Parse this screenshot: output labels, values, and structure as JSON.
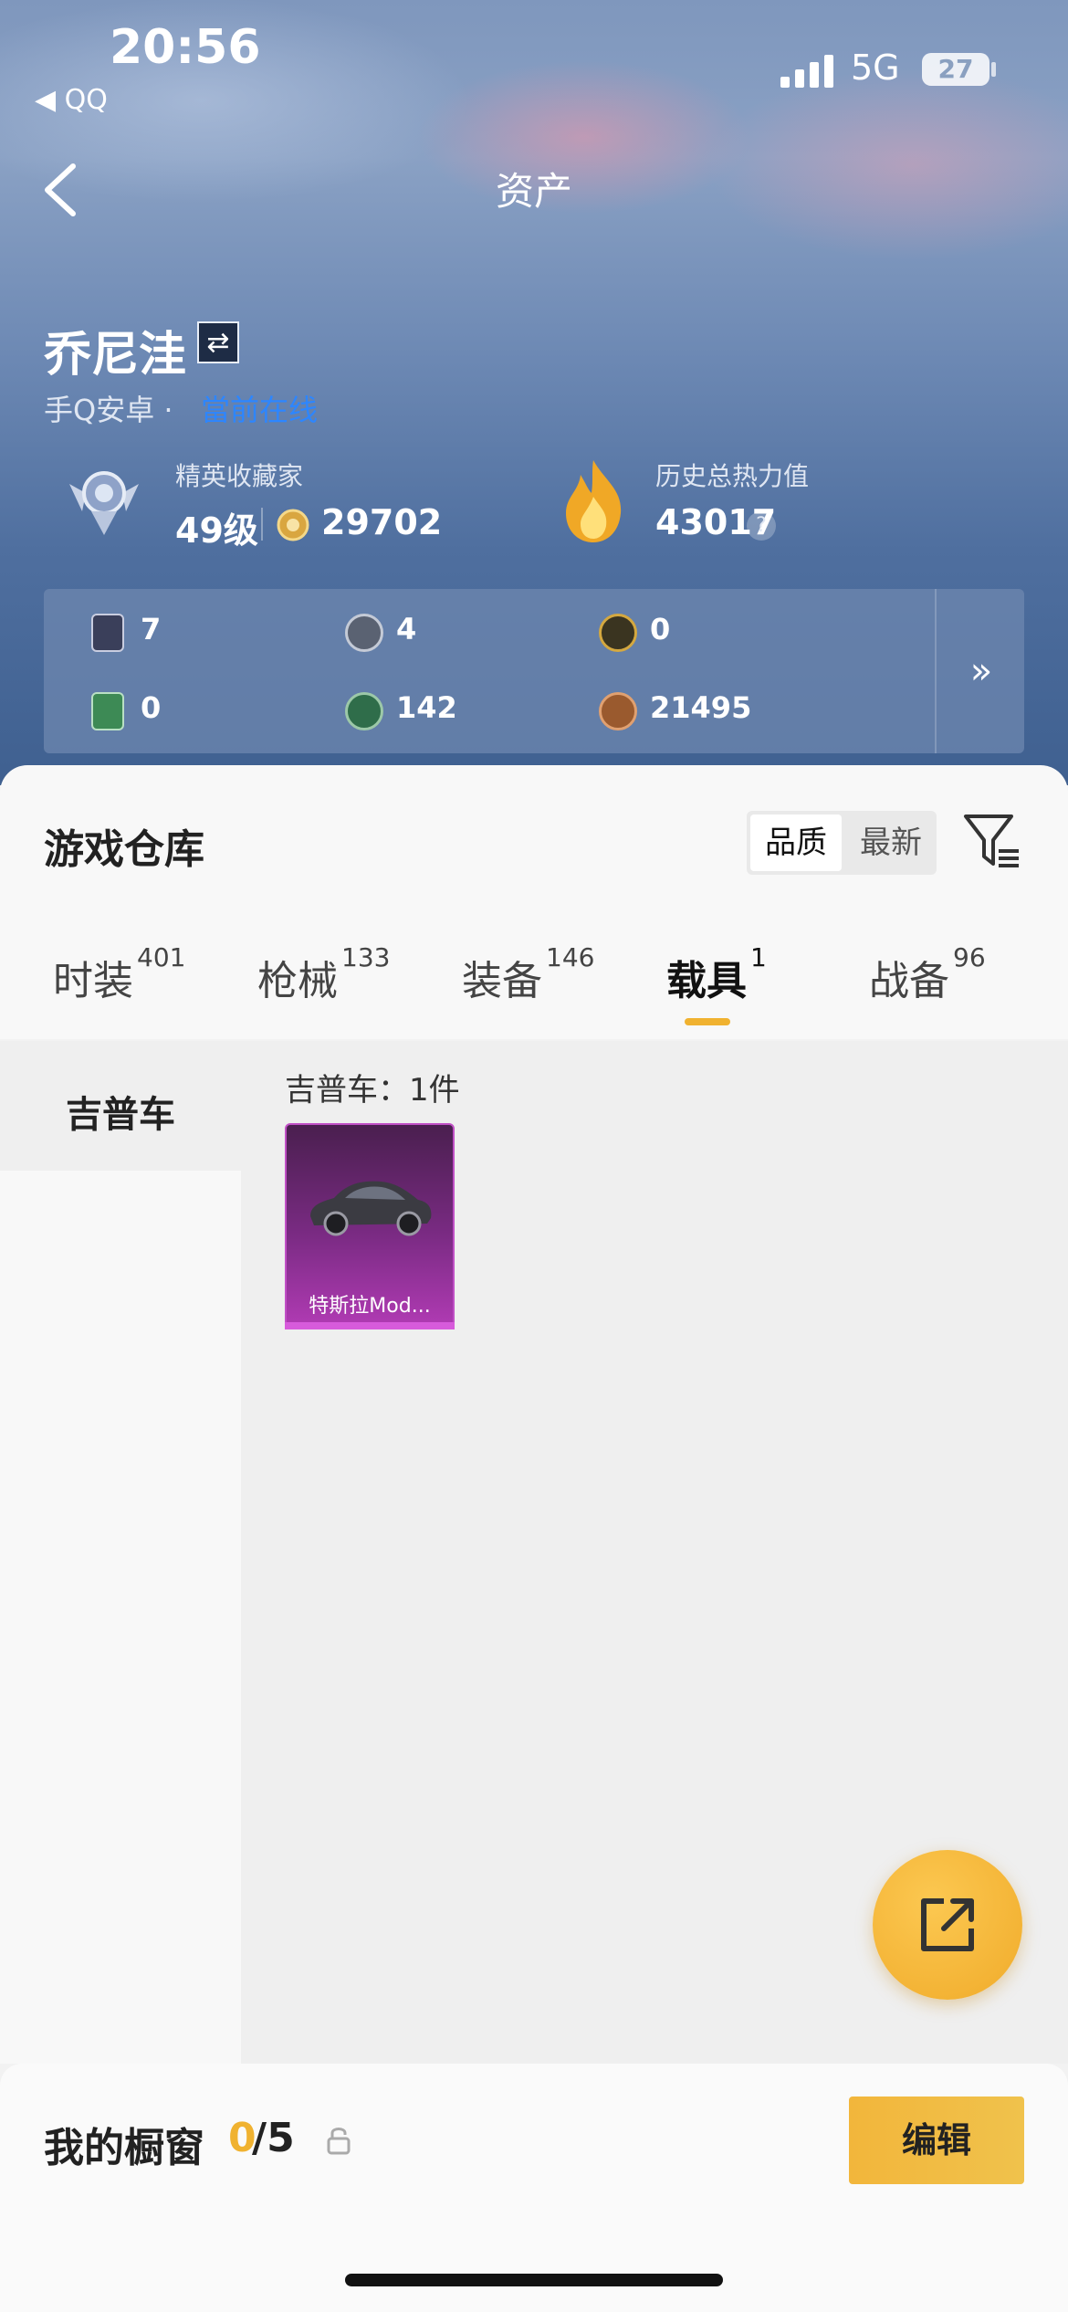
{
  "status_bar": {
    "time": "20:56",
    "back_app": "◀ QQ",
    "network": "5G",
    "battery": "27"
  },
  "nav": {
    "title": "资产",
    "back_icon": "chevron-left-icon"
  },
  "profile": {
    "name": "乔尼洼",
    "platform": "手Q安卓 ·",
    "status": "當前在线",
    "rank_label": "精英收藏家",
    "level": "49级",
    "coins": "29702",
    "heat_label": "历史总热力值",
    "heat_value": "43017",
    "help": "?"
  },
  "currencies": [
    {
      "value": "7",
      "icon": "card-purple-icon",
      "color": "#3a3f5a"
    },
    {
      "value": "4",
      "icon": "coin-silver-icon",
      "color": "#5a6272"
    },
    {
      "value": "0",
      "icon": "coin-gold-icon",
      "color": "#b08a2a"
    },
    {
      "value": "0",
      "icon": "card-green-icon",
      "color": "#3d8a55"
    },
    {
      "value": "142",
      "icon": "coin-green-icon",
      "color": "#2f6d4a"
    },
    {
      "value": "21495",
      "icon": "coin-bronze-icon",
      "color": "#9a5a2e"
    }
  ],
  "more_label": "»",
  "warehouse": {
    "title": "游戏仓库",
    "sort_options": [
      "品质",
      "最新"
    ],
    "tabs": [
      {
        "label": "时装",
        "count": "401"
      },
      {
        "label": "枪械",
        "count": "133"
      },
      {
        "label": "装备",
        "count": "146"
      },
      {
        "label": "载具",
        "count": "1"
      },
      {
        "label": "战备",
        "count": "96"
      }
    ],
    "active_tab": "载具",
    "side_category": "吉普车",
    "count_text": "吉普车：1件",
    "items": [
      {
        "name": "特斯拉Mod..."
      }
    ]
  },
  "showcase": {
    "label": "我的橱窗",
    "current": "0",
    "total": "/5",
    "edit": "编辑"
  },
  "colors": {
    "accent": "#f0b230",
    "card_purple": "#8a2d92",
    "online_blue": "#2d86ff"
  }
}
